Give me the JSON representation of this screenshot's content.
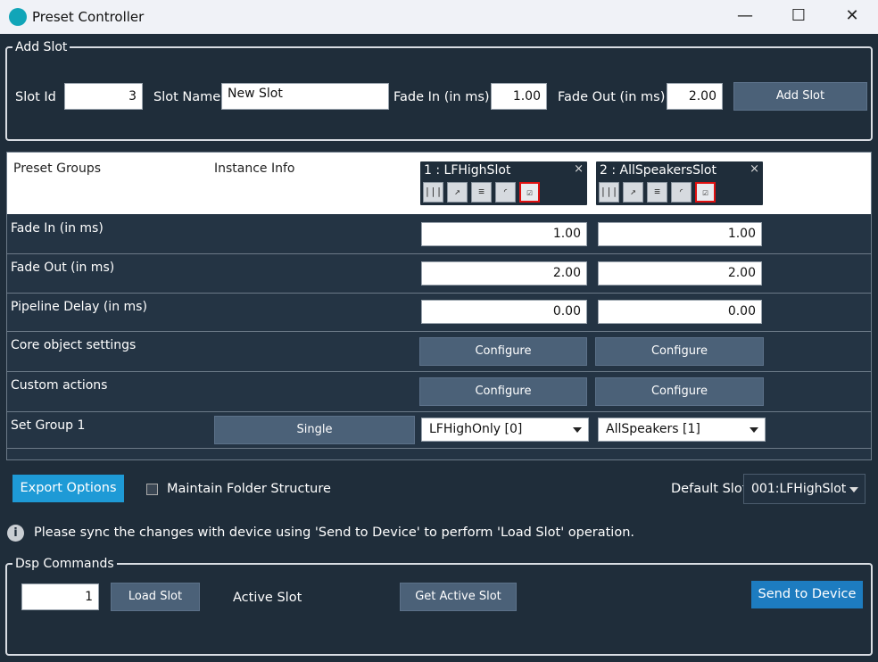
{
  "window": {
    "title": "Preset Controller",
    "minimize_glyph": "—",
    "maximize_glyph": "☐",
    "close_glyph": "✕"
  },
  "add_slot": {
    "legend": "Add Slot",
    "slot_id_label": "Slot Id",
    "slot_id_value": "3",
    "slot_name_label": "Slot Name",
    "slot_name_value": "New Slot",
    "fade_in_label": "Fade In (in ms)",
    "fade_in_value": "1.00",
    "fade_out_label": "Fade Out (in ms)",
    "fade_out_value": "2.00",
    "add_button": "Add Slot"
  },
  "grid": {
    "header": {
      "preset_groups": "Preset Groups",
      "instance_info": "Instance Info"
    },
    "slots": [
      {
        "title": "1 : LFHighSlot",
        "close": "×"
      },
      {
        "title": "2 : AllSpeakersSlot",
        "close": "×"
      }
    ],
    "rows": {
      "fade_in": {
        "label": "Fade In (in ms)",
        "values": [
          "1.00",
          "1.00"
        ]
      },
      "fade_out": {
        "label": "Fade Out (in ms)",
        "values": [
          "2.00",
          "2.00"
        ]
      },
      "pipeline_delay": {
        "label": "Pipeline Delay (in ms)",
        "values": [
          "0.00",
          "0.00"
        ]
      },
      "core_object": {
        "label": "Core object settings",
        "buttons": [
          "Configure",
          "Configure"
        ]
      },
      "custom_actions": {
        "label": "Custom actions",
        "buttons": [
          "Configure",
          "Configure"
        ]
      },
      "set_group": {
        "label": "Set Group 1",
        "mode_button": "Single",
        "selections": [
          "LFHighOnly [0]",
          "AllSpeakers [1]"
        ]
      }
    }
  },
  "options": {
    "export_button": "Export Options",
    "maintain_folder_label": "Maintain Folder Structure",
    "maintain_folder_checked": false,
    "default_slot_label": "Default Slot",
    "default_slot_value": "001:LFHighSlot"
  },
  "info": {
    "icon": "info-icon",
    "message": "Please sync the changes with device using 'Send to Device' to perform 'Load Slot' operation."
  },
  "dsp": {
    "legend": "Dsp Commands",
    "slot_value": "1",
    "load_button": "Load Slot",
    "active_slot_label": "Active Slot",
    "get_active_button": "Get Active Slot",
    "send_button": "Send to Device"
  },
  "colors": {
    "background": "#1f2d3a",
    "button": "#4b6178",
    "accent_blue": "#1e9ad6",
    "send_blue": "#1d7cc0",
    "highlight_red": "#e01010"
  }
}
